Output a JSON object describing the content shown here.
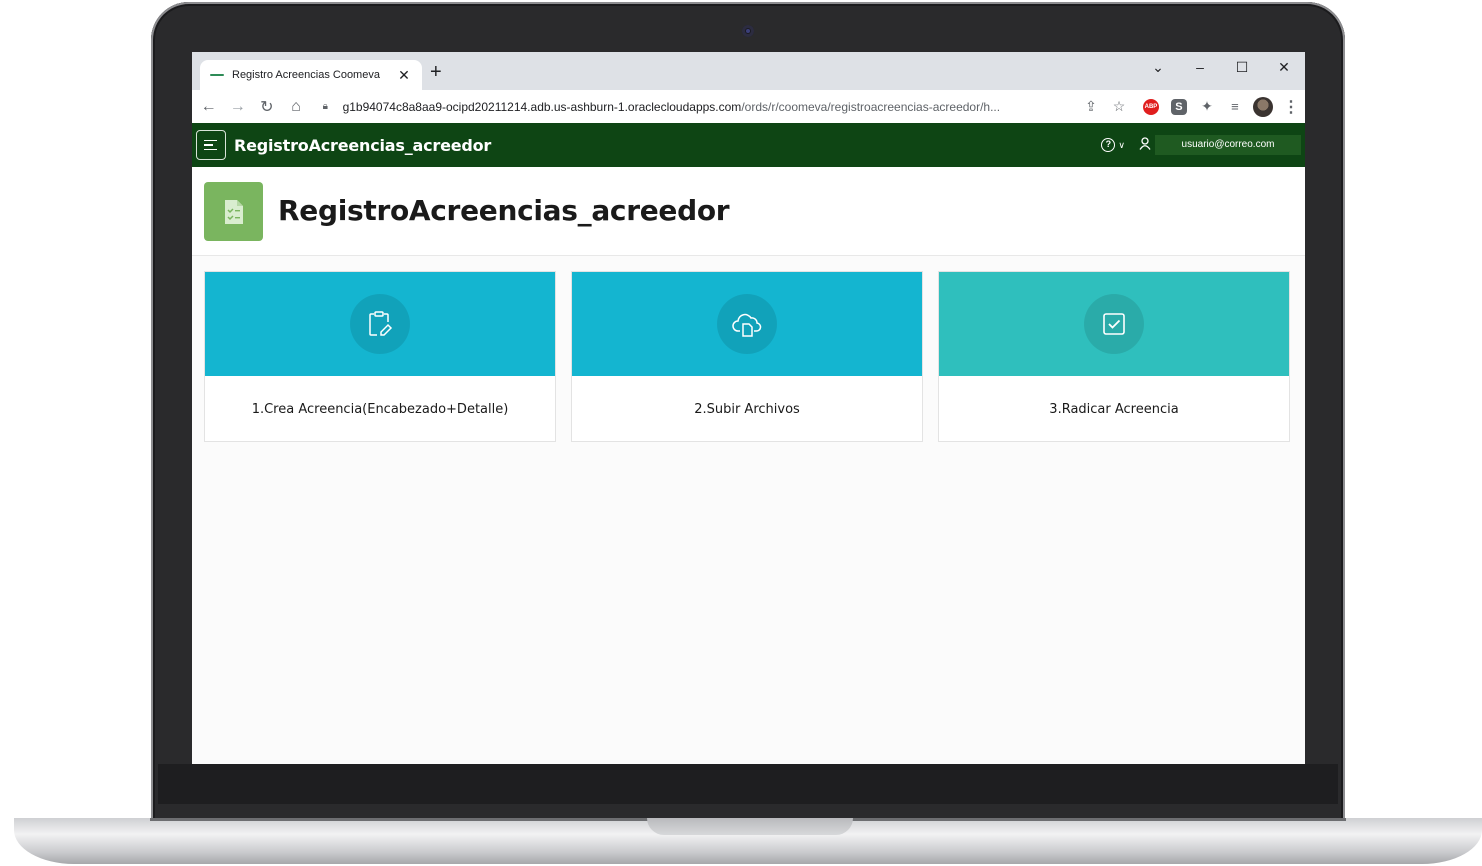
{
  "browser": {
    "tab_title": "Registro Acreencias Coomeva",
    "url_host": "g1b94074c8a8aa9-ocipd20211214.adb.us-ashburn-1.oraclecloudapps.com",
    "url_path": "/ords/r/coomeva/registroacreencias-acreedor/h...",
    "abp_label": "ABP"
  },
  "header": {
    "app_title": "RegistroAcreencias_acreedor",
    "user_email": "usuario@correo.com",
    "brand_color": "#0e4514"
  },
  "page": {
    "title": "RegistroAcreencias_acreedor"
  },
  "cards": [
    {
      "label": "1.Crea Acreencia(Encabezado+Detalle)",
      "icon": "clipboard-edit-icon",
      "color": "#14b5d0"
    },
    {
      "label": "2.Subir Archivos",
      "icon": "cloud-file-icon",
      "color": "#14b5d0"
    },
    {
      "label": "3.Radicar Acreencia",
      "icon": "check-square-icon",
      "color": "#2fbfbd"
    }
  ]
}
